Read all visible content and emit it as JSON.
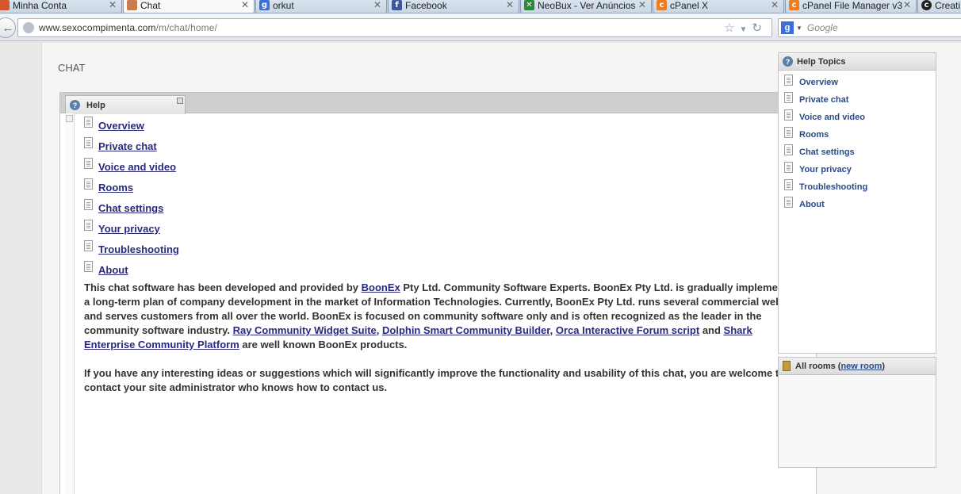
{
  "browser": {
    "tabs": [
      {
        "label": "Minha Conta",
        "icon": "account-favicon",
        "color": "#d4572a",
        "active": false
      },
      {
        "label": "Chat",
        "icon": "chat-favicon",
        "color": "#c97b4a",
        "active": true
      },
      {
        "label": "orkut",
        "icon": "google-favicon",
        "color": "#3b6fd8",
        "active": false
      },
      {
        "label": "Facebook",
        "icon": "facebook-favicon",
        "color": "#3b5998",
        "active": false
      },
      {
        "label": "NeoBux - Ver Anúncios",
        "icon": "neobux-favicon",
        "color": "#2a8a3a",
        "active": false
      },
      {
        "label": "cPanel X",
        "icon": "cpanel-favicon",
        "color": "#f07c1b",
        "active": false
      },
      {
        "label": "cPanel File Manager v3",
        "icon": "cpanel-favicon",
        "color": "#f07c1b",
        "active": false
      },
      {
        "label": "Creati",
        "icon": "creative-commons-favicon",
        "color": "#222222",
        "active": false
      }
    ],
    "url_host": "www.sexocompimenta.com",
    "url_path": "/m/chat/home/",
    "search_placeholder": "Google"
  },
  "page": {
    "title": "CHAT"
  },
  "help": {
    "tab_label": "Help",
    "links": [
      "Overview",
      "Private chat",
      "Voice and video",
      "Rooms",
      "Chat settings",
      "Your privacy",
      "Troubleshooting",
      "About"
    ],
    "para1": {
      "t1": "This chat software has been developed and provided by ",
      "boonex": "BoonEx",
      "t2": " Pty Ltd. Community Software Experts. BoonEx Pty Ltd. is gradually implementing a long-term plan of company development in the market of Information Technologies. Currently, BoonEx Pty Ltd. runs several commercial websites and serves customers from all over the world. BoonEx is focused on community software only and is often recognized as the leader in the community software industry. ",
      "ray": "Ray Community Widget Suite",
      "sep1": ", ",
      "dolphin": "Dolphin Smart Community Builder",
      "sep2": ", ",
      "orca": "Orca Interactive Forum script",
      "t3": " and ",
      "shark": "Shark Enterprise Community Platform",
      "t4": " are well known BoonEx products."
    },
    "para2": "If you have any interesting ideas or suggestions which will significantly improve the functionality and usability of this chat, you are welcome to contact your site administrator who knows how to contact us."
  },
  "topics": {
    "title": "Help Topics",
    "items": [
      "Overview",
      "Private chat",
      "Voice and video",
      "Rooms",
      "Chat settings",
      "Your privacy",
      "Troubleshooting",
      "About"
    ]
  },
  "rooms": {
    "label": "All rooms (",
    "new_room": "new room",
    "close": ")"
  }
}
